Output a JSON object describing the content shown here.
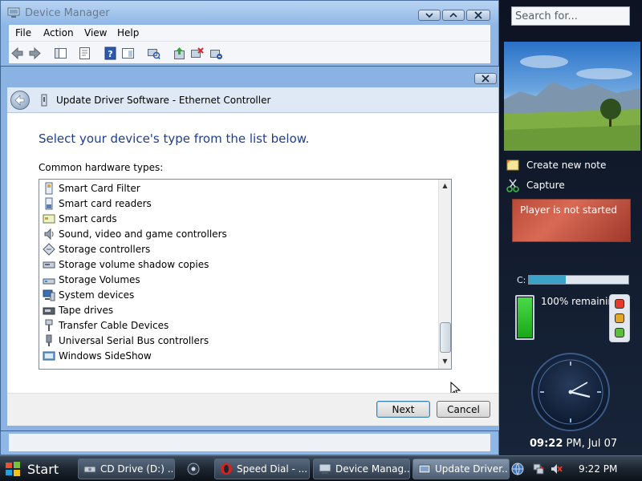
{
  "device_manager": {
    "title": "Device Manager",
    "menu": [
      "File",
      "Action",
      "View",
      "Help"
    ]
  },
  "dialog": {
    "title": "Update Driver Software - Ethernet Controller",
    "heading": "Select your device's type from the list below.",
    "list_label": "Common hardware types:",
    "items": [
      {
        "label": "Smart Card Filter",
        "icon": "smart-card-filter-icon"
      },
      {
        "label": "Smart card readers",
        "icon": "smart-card-reader-icon"
      },
      {
        "label": "Smart cards",
        "icon": "smart-card-icon"
      },
      {
        "label": "Sound, video and game controllers",
        "icon": "speaker-icon"
      },
      {
        "label": "Storage controllers",
        "icon": "storage-controller-icon"
      },
      {
        "label": "Storage volume shadow copies",
        "icon": "shadow-copy-icon"
      },
      {
        "label": "Storage Volumes",
        "icon": "volume-icon"
      },
      {
        "label": "System devices",
        "icon": "computer-icon"
      },
      {
        "label": "Tape drives",
        "icon": "tape-drive-icon"
      },
      {
        "label": "Transfer Cable Devices",
        "icon": "cable-icon"
      },
      {
        "label": "Universal Serial Bus controllers",
        "icon": "usb-icon"
      },
      {
        "label": "Windows SideShow",
        "icon": "sideshow-icon"
      }
    ],
    "next_label": "Next",
    "cancel_label": "Cancel"
  },
  "sidebar": {
    "search_placeholder": "Search for...",
    "create_note": "Create new note",
    "capture": "Capture",
    "player_status": "Player is not started",
    "disk_label": "C:",
    "disk_used_fraction": 0.37,
    "battery_text": "100% remaining",
    "battery_level": 1.0,
    "clock_time": "09:22",
    "clock_suffix": " PM, Jul 07"
  },
  "taskbar": {
    "start_label": "Start",
    "tasks": [
      "CD Drive (D:) ...",
      "Speed Dial - ...",
      "Device Manag...",
      "Update Driver..."
    ],
    "tray_time": "9:22 PM"
  },
  "colors": {
    "heading": "#1e3d8f",
    "accent": "#3c7fb1"
  }
}
